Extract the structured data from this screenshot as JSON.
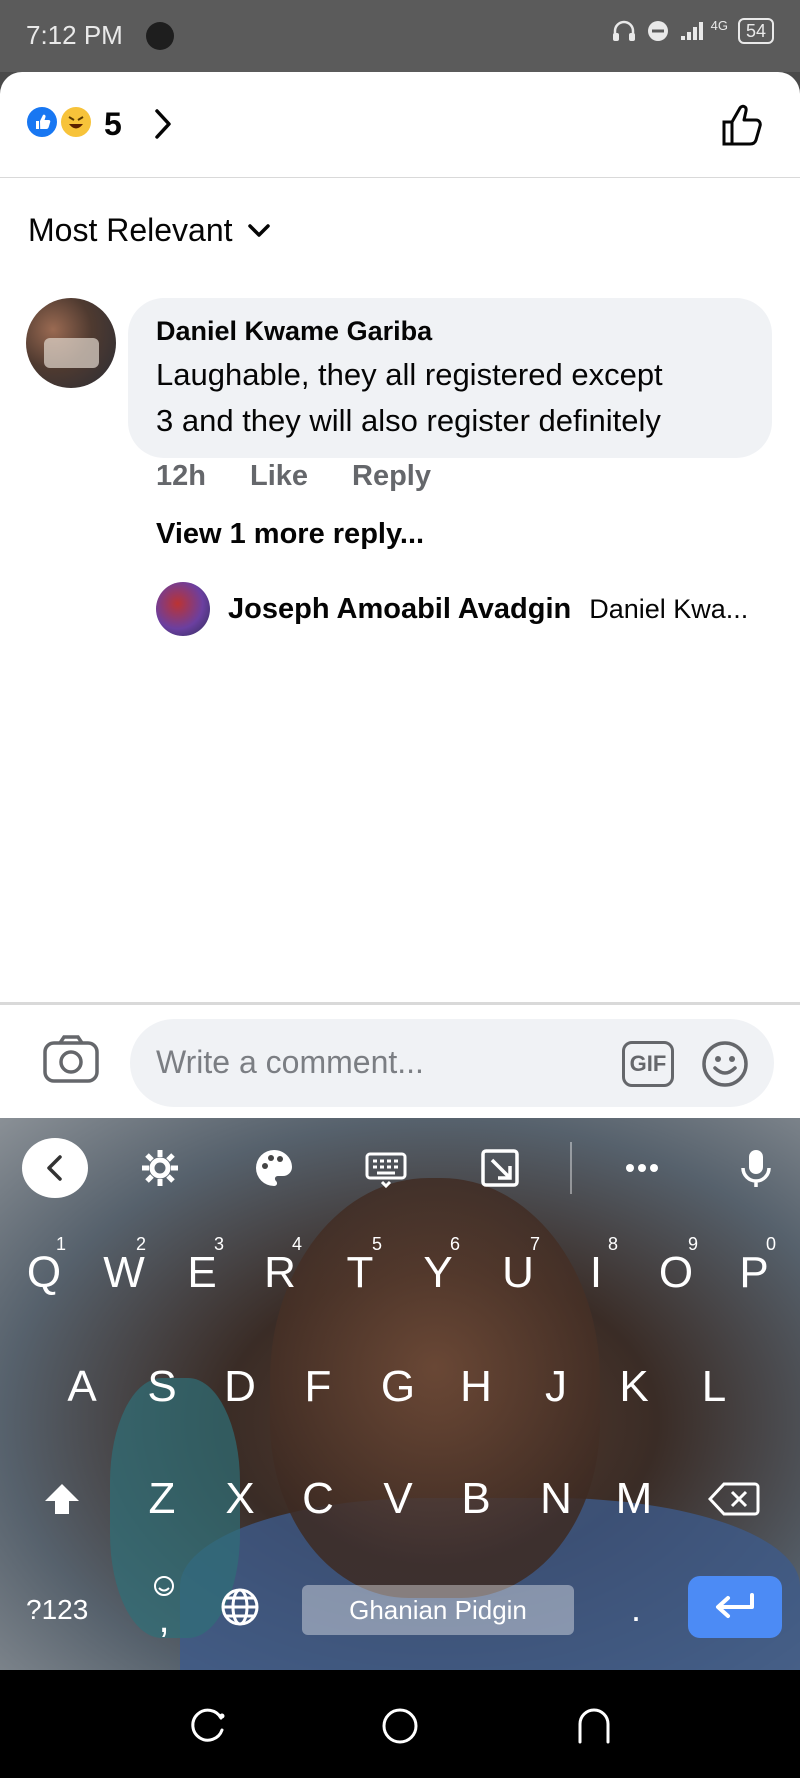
{
  "status_bar": {
    "time": "7:12 PM",
    "network": "4G",
    "battery": "54"
  },
  "reactions": {
    "count": "5",
    "icons": [
      "like-icon",
      "haha-icon"
    ]
  },
  "sort": {
    "label": "Most Relevant"
  },
  "comment": {
    "author": "Daniel Kwame Gariba",
    "text_line1": "Laughable, they all registered except",
    "text_line2": "3 and they will also register definitely",
    "time": "12h",
    "like_label": "Like",
    "reply_label": "Reply",
    "view_more": "View 1 more reply..."
  },
  "reply_preview": {
    "author": "Joseph Amoabil Avadgin",
    "snippet": "Daniel Kwa..."
  },
  "composer": {
    "placeholder": "Write a comment...",
    "gif_label": "GIF"
  },
  "keyboard": {
    "row1": [
      "Q",
      "W",
      "E",
      "R",
      "T",
      "Y",
      "U",
      "I",
      "O",
      "P"
    ],
    "row1_nums": [
      "1",
      "2",
      "3",
      "4",
      "5",
      "6",
      "7",
      "8",
      "9",
      "0"
    ],
    "row2": [
      "A",
      "S",
      "D",
      "F",
      "G",
      "H",
      "J",
      "K",
      "L"
    ],
    "row3": [
      "Z",
      "X",
      "C",
      "V",
      "B",
      "N",
      "M"
    ],
    "num_key": "?123",
    "comma": ",",
    "period": ".",
    "space_label": "Ghanian Pidgin"
  },
  "colors": {
    "accent": "#1877f2",
    "enter_key": "#4c8bf5",
    "bubble": "#f0f2f5",
    "muted_text": "#65676b"
  }
}
